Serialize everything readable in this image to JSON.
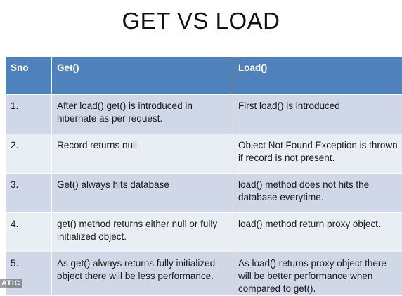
{
  "title": "GET VS LOAD",
  "table": {
    "headers": [
      "Sno",
      "Get()",
      "Load()"
    ],
    "rows": [
      {
        "sno": "1.",
        "get": "After load() get() is introduced in hibernate as per request.",
        "load": "First load() is introduced"
      },
      {
        "sno": "2.",
        "get": "Record returns null",
        "load": "Object Not Found Exception is thrown if record is not present."
      },
      {
        "sno": "3.",
        "get": "Get() always hits database",
        "load": "load() method does not hits the database everytime."
      },
      {
        "sno": "4.",
        "get": "get() method returns either null or fully initialized object.",
        "load": "load() method return proxy object."
      },
      {
        "sno": "5.",
        "get": "As get()  always returns  fully initialized object there will be less performance.",
        "load": "As load() returns proxy object there will be better performance when compared to get()."
      }
    ]
  },
  "watermark": "ATIC",
  "colors": {
    "header": "#4f81bd",
    "row_dark": "#d0d8e8",
    "row_light": "#e9edf4"
  }
}
